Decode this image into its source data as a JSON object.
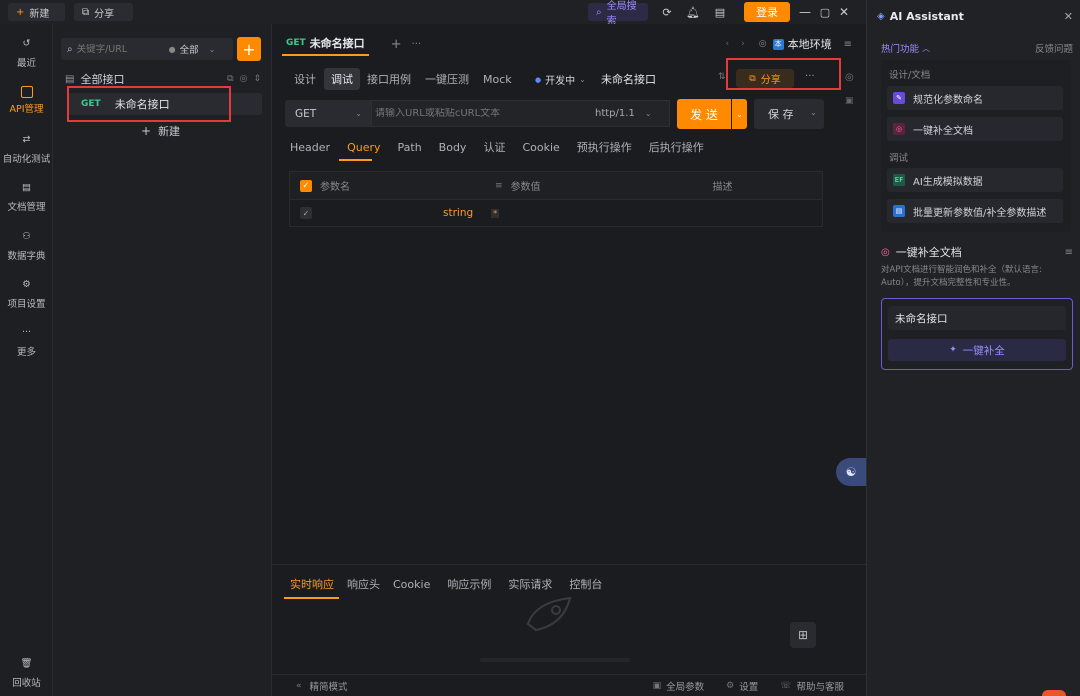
{
  "titlebar": {
    "new_label": "新建",
    "share_label": "分享",
    "global_search": "全局搜索",
    "login": "登录"
  },
  "nav": [
    {
      "label": "最近",
      "icon": "history-icon"
    },
    {
      "label": "API管理",
      "icon": "api-icon"
    },
    {
      "label": "自动化测试",
      "icon": "automation-icon"
    },
    {
      "label": "文档管理",
      "icon": "document-icon"
    },
    {
      "label": "数据字典",
      "icon": "dictionary-icon"
    },
    {
      "label": "项目设置",
      "icon": "project-settings-icon"
    },
    {
      "label": "更多",
      "icon": "more-icon"
    },
    {
      "label": "回收站",
      "icon": "trash-icon"
    }
  ],
  "tree": {
    "search_placeholder": "关键字/URL",
    "filter": "全部",
    "root": "全部接口",
    "item_method": "GET",
    "item_name": "未命名接口",
    "new_label": "新建"
  },
  "main": {
    "tab_method": "GET",
    "tab_title": "未命名接口",
    "env": "本地环境",
    "subtabs": [
      "设计",
      "调试",
      "接口用例",
      "一键压测",
      "Mock"
    ],
    "status": "开发中",
    "api_name": "未命名接口",
    "share": "分享",
    "more": "···",
    "method": "GET",
    "url_placeholder": "请输入URL或粘贴cURL文本",
    "protocol": "http/1.1",
    "send": "发 送",
    "save": "保 存",
    "param_tabs": [
      "Header",
      "Query",
      "Path",
      "Body",
      "认证",
      "Cookie",
      "预执行操作",
      "后执行操作"
    ],
    "param_headers": [
      "参数名",
      "参数值",
      "描述"
    ],
    "row_type": "string",
    "resp_tabs": [
      "实时响应",
      "响应头",
      "Cookie",
      "响应示例",
      "实际请求",
      "控制台"
    ],
    "footer": {
      "compact": "精简模式",
      "global_params": "全局参数",
      "settings": "设置",
      "help": "帮助与客服"
    }
  },
  "assistant": {
    "title": "AI Assistant",
    "hot": "热门功能",
    "feedback": "反馈问题",
    "section1": "设计/文档",
    "item1": "规范化参数命名",
    "item2": "一键补全文档",
    "section2": "调试",
    "item3": "AI生成模拟数据",
    "item4": "批量更新参数值/补全参数描述",
    "card_title": "一键补全文档",
    "card_desc": "对API文档进行智能润色和补全（默认语言: Auto），提升文档完整性和专业性。",
    "input_value": "未命名接口",
    "action": "一键补全"
  },
  "colors": {
    "accent": "#ff9a1f",
    "method_get": "#3fc88f",
    "ai_purple": "#7b6cf0",
    "highlight": "#e53a3a"
  }
}
